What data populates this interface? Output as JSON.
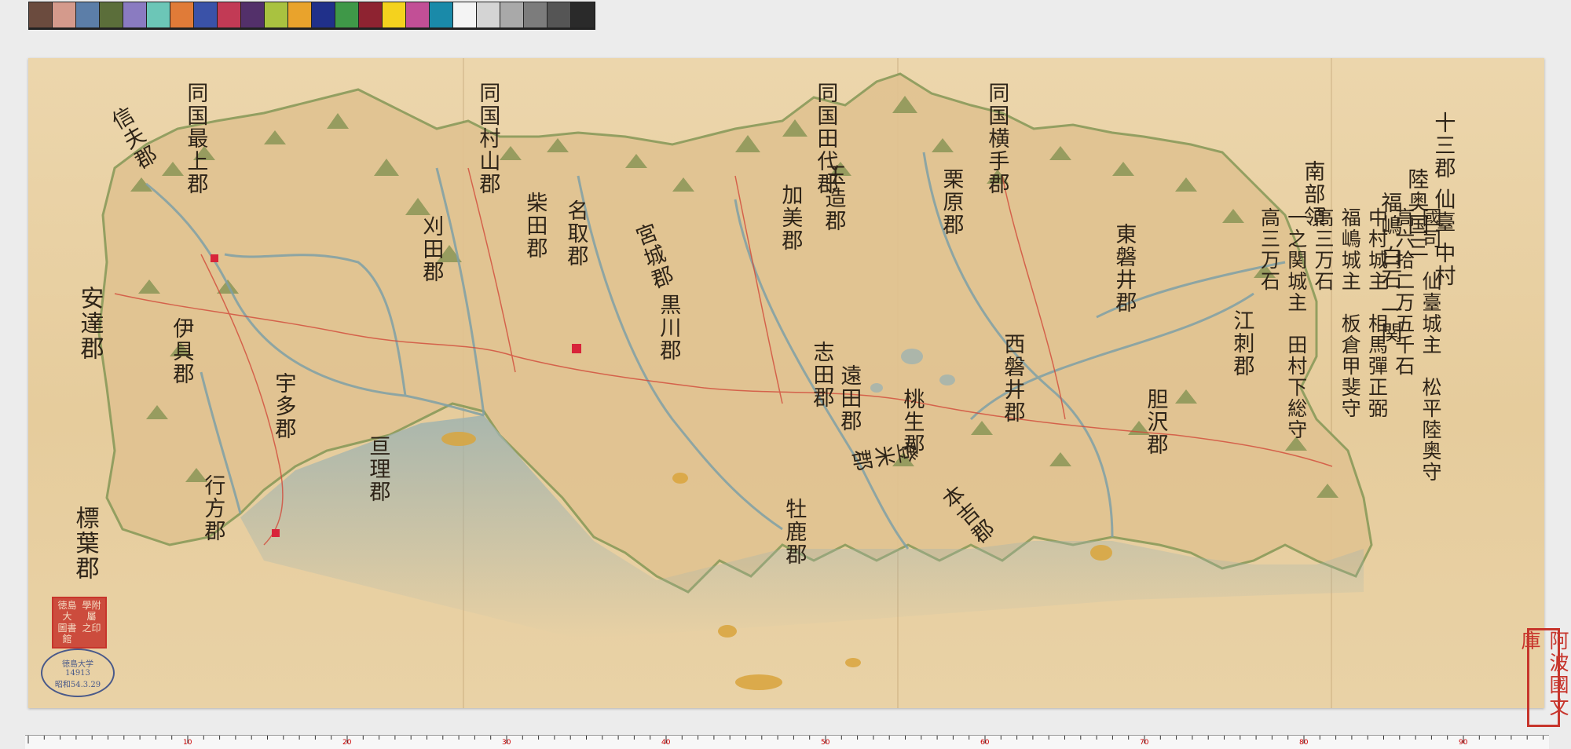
{
  "color_target": {
    "swatches": [
      "#6b4b3e",
      "#d49a8c",
      "#5c7ea8",
      "#5b6e3a",
      "#8a7bc1",
      "#6cc6b7",
      "#e07b38",
      "#3a52a8",
      "#c23a55",
      "#53306a",
      "#a9c240",
      "#e9a32c",
      "#20308a",
      "#3f9848",
      "#8e2331",
      "#f4d21e",
      "#c24f96",
      "#1a8aa9",
      "#f4f4f4",
      "#d4d4d4",
      "#a9a9a9",
      "#7c7c7c",
      "#555555",
      "#2a2a2a"
    ]
  },
  "map": {
    "heading": {
      "line1": "陸奥国三",
      "line2": "十三郡 仙臺 中村",
      "line3": "福嶋 白石 一関"
    },
    "legend": [
      {
        "text": "國司　仙臺城主　松平陸奥守"
      },
      {
        "text": "高六拾二万五千石"
      },
      {
        "text": "中村城主　相馬彈正弼"
      },
      {
        "text": "福嶋城主　板倉甲斐守"
      },
      {
        "text": "高三万石"
      },
      {
        "text": "一之関城主　田村下総守"
      },
      {
        "text": "高三万石"
      }
    ],
    "districts": [
      {
        "name": "刈田郡"
      },
      {
        "name": "柴田郡"
      },
      {
        "name": "名取郡"
      },
      {
        "name": "宮城郡"
      },
      {
        "name": "黒川郡"
      },
      {
        "name": "志田郡"
      },
      {
        "name": "遠田郡"
      },
      {
        "name": "登米郡"
      },
      {
        "name": "東磐井郡"
      },
      {
        "name": "西磐井郡"
      },
      {
        "name": "江刺郡"
      },
      {
        "name": "亘理郡"
      },
      {
        "name": "伊具郡"
      },
      {
        "name": "宇多郡"
      },
      {
        "name": "行方郡"
      },
      {
        "name": "桃生郡"
      },
      {
        "name": "牡鹿郡"
      },
      {
        "name": "本吉郡"
      },
      {
        "name": "栗原郡"
      },
      {
        "name": "玉造郡"
      },
      {
        "name": "加美郡"
      },
      {
        "name": "胆沢郡"
      }
    ],
    "border_labels": [
      {
        "name": "同国最上郡"
      },
      {
        "name": "同国村山郡"
      },
      {
        "name": "同国田代郡"
      },
      {
        "name": "同国横手郡"
      },
      {
        "name": "南部領"
      },
      {
        "name": "信夫郡"
      },
      {
        "name": "安達郡"
      },
      {
        "name": "標葉郡"
      }
    ],
    "stamps": {
      "awa": "阿波國文庫",
      "seal": [
        "徳島大",
        "學附屬",
        "圖書館",
        "之印"
      ],
      "oval": [
        "徳島大学",
        "14913",
        "昭和54.3.29"
      ]
    },
    "colors": {
      "paper": "#e8cfa0",
      "mountain": "#7d8f4e",
      "river": "#7fa0a6",
      "road": "#d24a3a",
      "sea_shade": "#9fb3b0",
      "castle": "#d8243a",
      "island": "#d9a43c"
    }
  },
  "ruler": {
    "labels": [
      "10",
      "20",
      "30",
      "40",
      "50",
      "60",
      "70",
      "80",
      "90"
    ]
  }
}
